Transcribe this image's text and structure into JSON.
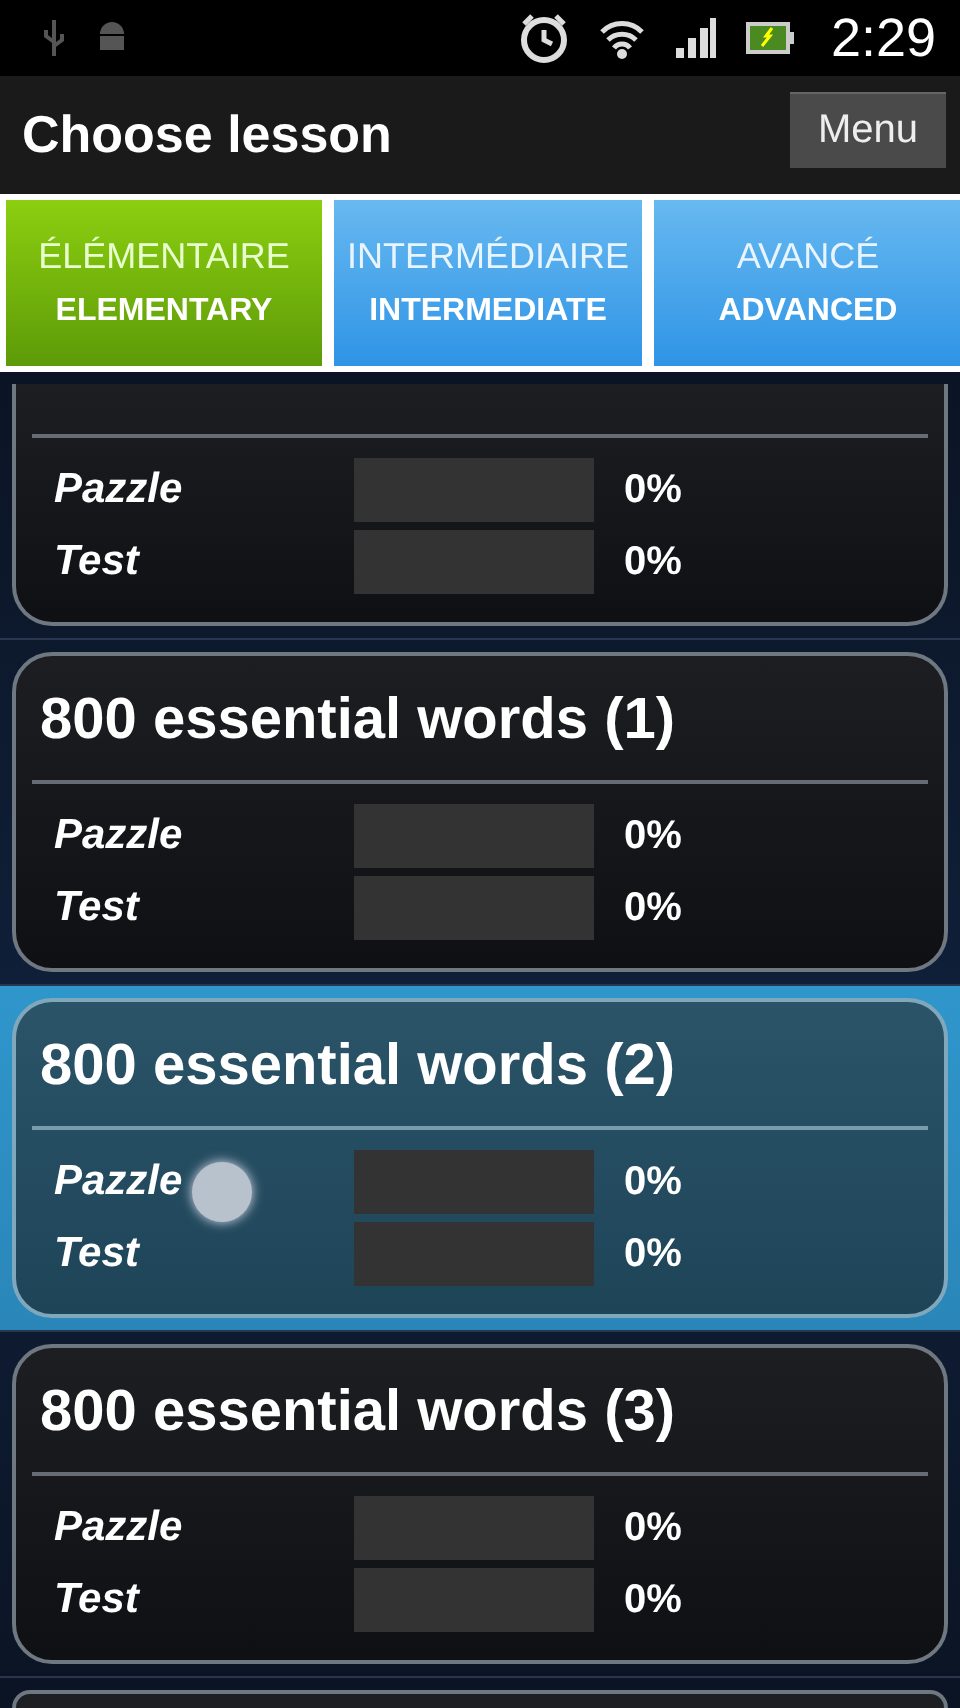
{
  "status_bar": {
    "time": "2:29"
  },
  "header": {
    "title": "Choose lesson",
    "menu_button": "Menu"
  },
  "tabs": [
    {
      "label": "ÉLÉMENTAIRE",
      "sublabel": "ELEMENTARY",
      "selected": true
    },
    {
      "label": "INTERMÉDIAIRE",
      "sublabel": "INTERMEDIATE",
      "selected": false
    },
    {
      "label": "AVANCÉ",
      "sublabel": "ADVANCED",
      "selected": false
    }
  ],
  "lessons": [
    {
      "selected": false,
      "rows": [
        {
          "label": "Pazzle",
          "level": 0,
          "reading": "0%"
        },
        {
          "label": "Test",
          "level": 0,
          "reading": "0%"
        }
      ]
    },
    {
      "title": "800 essential words (1)",
      "selected": false,
      "rows": [
        {
          "label": "Pazzle",
          "level": 0,
          "reading": "0%"
        },
        {
          "label": "Test",
          "level": 0,
          "reading": "0%"
        }
      ]
    },
    {
      "title": "800 essential words (2)",
      "selected": true,
      "rows": [
        {
          "label": "Pazzle",
          "level": 0,
          "reading": "0%"
        },
        {
          "label": "Test",
          "level": 0,
          "reading": "0%"
        }
      ]
    },
    {
      "title": "800 essential words (3)",
      "selected": false,
      "rows": [
        {
          "label": "Pazzle",
          "level": 0,
          "reading": "0%"
        },
        {
          "label": "Test",
          "level": 0,
          "reading": "0%"
        }
      ]
    }
  ]
}
